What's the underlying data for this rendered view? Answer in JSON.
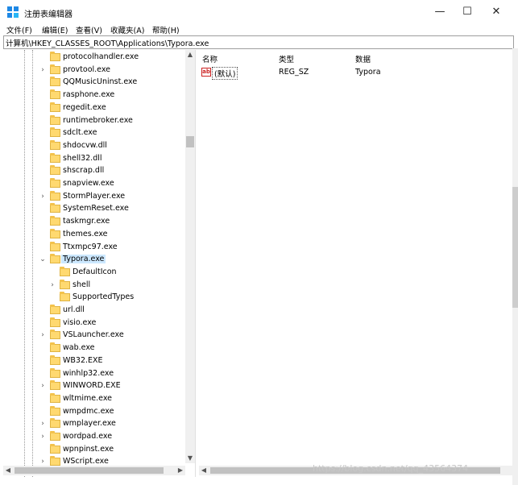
{
  "window": {
    "title": "注册表编辑器",
    "minimize_glyph": "—",
    "maximize_glyph": "☐",
    "close_glyph": "✕"
  },
  "menu": [
    "文件(F)",
    "编辑(E)",
    "查看(V)",
    "收藏夹(A)",
    "帮助(H)"
  ],
  "address": "计算机\\HKEY_CLASSES_ROOT\\Applications\\Typora.exe",
  "tree": {
    "items": [
      {
        "label": "protocolhandler.exe",
        "expandable": false
      },
      {
        "label": "provtool.exe",
        "expandable": true
      },
      {
        "label": "QQMusicUninst.exe",
        "expandable": false
      },
      {
        "label": "rasphone.exe",
        "expandable": false
      },
      {
        "label": "regedit.exe",
        "expandable": false
      },
      {
        "label": "runtimebroker.exe",
        "expandable": false
      },
      {
        "label": "sdclt.exe",
        "expandable": false
      },
      {
        "label": "shdocvw.dll",
        "expandable": false
      },
      {
        "label": "shell32.dll",
        "expandable": false
      },
      {
        "label": "shscrap.dll",
        "expandable": false
      },
      {
        "label": "snapview.exe",
        "expandable": false
      },
      {
        "label": "StormPlayer.exe",
        "expandable": true
      },
      {
        "label": "SystemReset.exe",
        "expandable": false
      },
      {
        "label": "taskmgr.exe",
        "expandable": false
      },
      {
        "label": "themes.exe",
        "expandable": false
      },
      {
        "label": "Ttxmpc97.exe",
        "expandable": false
      },
      {
        "label": "Typora.exe",
        "expandable": true,
        "expanded": true,
        "selected": true
      },
      {
        "label": "DefaultIcon",
        "expandable": false,
        "child": true
      },
      {
        "label": "shell",
        "expandable": true,
        "child": true
      },
      {
        "label": "SupportedTypes",
        "expandable": false,
        "child": true
      },
      {
        "label": "url.dll",
        "expandable": false
      },
      {
        "label": "visio.exe",
        "expandable": false
      },
      {
        "label": "VSLauncher.exe",
        "expandable": true
      },
      {
        "label": "wab.exe",
        "expandable": false
      },
      {
        "label": "WB32.EXE",
        "expandable": false
      },
      {
        "label": "winhlp32.exe",
        "expandable": false
      },
      {
        "label": "WINWORD.EXE",
        "expandable": true
      },
      {
        "label": "wltmime.exe",
        "expandable": false
      },
      {
        "label": "wmpdmc.exe",
        "expandable": false
      },
      {
        "label": "wmplayer.exe",
        "expandable": true
      },
      {
        "label": "wordpad.exe",
        "expandable": true
      },
      {
        "label": "wpnpinst.exe",
        "expandable": false
      },
      {
        "label": "WScript.exe",
        "expandable": true
      }
    ]
  },
  "values": {
    "headers": {
      "name": "名称",
      "type": "类型",
      "data": "数据"
    },
    "rows": [
      {
        "icon": "ab",
        "name": "(默认)",
        "type": "REG_SZ",
        "data": "Typora"
      }
    ]
  },
  "watermark": "https://blog.csdn.net/qq_43564374",
  "colors": {
    "selection": "#cce8ff",
    "folder": "#ffd970"
  }
}
